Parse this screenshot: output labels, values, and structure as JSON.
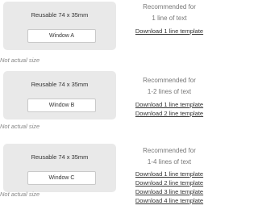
{
  "items": [
    {
      "card_label": "Reusable  74 x 35mm",
      "window_label": "Window A",
      "note": "Not actual size",
      "recommended": "Recommended for",
      "lines_text": "1 line of text",
      "downloads": [
        "Download 1 line template"
      ]
    },
    {
      "card_label": "Reusable  74 x 35mm",
      "window_label": "Window B",
      "note": "Not actual size",
      "recommended": "Recommended for",
      "lines_text": "1-2 lines of text",
      "downloads": [
        "Download 1 line template",
        "Download 2 line template"
      ]
    },
    {
      "card_label": "Reusable  74 x 35mm",
      "window_label": "Window C",
      "note": "Not actual size",
      "recommended": "Recommended for",
      "lines_text": "1-4 lines of text",
      "downloads": [
        "Download 1 line template",
        "Download 2 line template",
        "Download 3 line template",
        "Download 4 line template"
      ]
    }
  ]
}
